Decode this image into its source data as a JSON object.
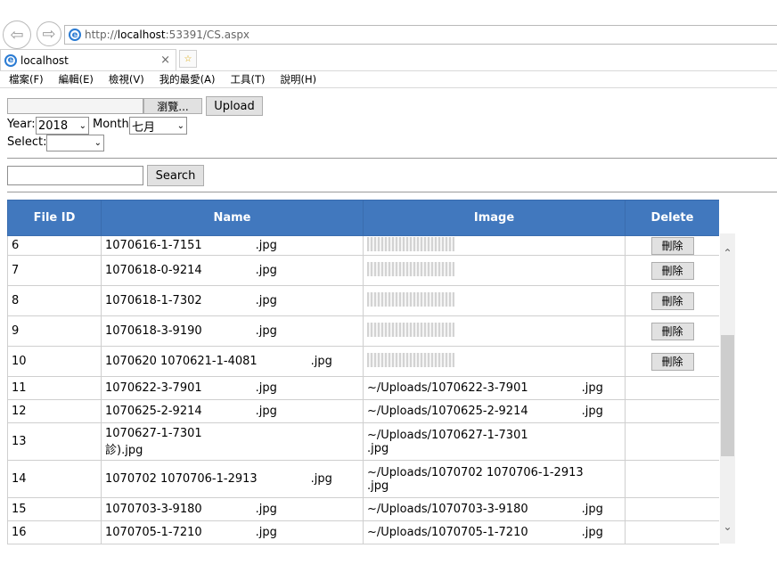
{
  "browser": {
    "url_prefix": "http://",
    "url_host": "localhost",
    "url_rest": ":53391/CS.aspx",
    "tab_title": "localhost",
    "tab_close": "×",
    "menu": [
      "檔案(F)",
      "編輯(E)",
      "檢視(V)",
      "我的最愛(A)",
      "工具(T)",
      "說明(H)"
    ]
  },
  "form": {
    "browse_label": "瀏覽...",
    "upload_label": "Upload",
    "year_label": "Year:",
    "year_value": "2018",
    "month_label": "Month:",
    "month_value": "七月",
    "select_label": "Select:",
    "select_value": "",
    "search_value": "",
    "search_label": "Search"
  },
  "grid": {
    "headers": [
      "File ID",
      "Name",
      "Image",
      "Delete"
    ],
    "delete_label": "刪除",
    "rows": [
      {
        "id": "6",
        "name": "1070616-1-7151",
        "ext": ".jpg",
        "image": "",
        "has_thumb": true,
        "has_delete": true
      },
      {
        "id": "7",
        "name": "1070618-0-9214",
        "ext": ".jpg",
        "image": "",
        "has_thumb": true,
        "has_delete": true
      },
      {
        "id": "8",
        "name": "1070618-1-7302",
        "ext": ".jpg",
        "image": "",
        "has_thumb": true,
        "has_delete": true
      },
      {
        "id": "9",
        "name": "1070618-3-9190",
        "ext": ".jpg",
        "image": "",
        "has_thumb": true,
        "has_delete": true
      },
      {
        "id": "10",
        "name": "1070620 1070621-1-4081",
        "ext": ".jpg",
        "image": "",
        "has_thumb": true,
        "has_delete": true
      },
      {
        "id": "11",
        "name": "1070622-3-7901",
        "ext": ".jpg",
        "image": "~/Uploads/1070622-3-7901",
        "image_ext": ".jpg",
        "has_thumb": false,
        "has_delete": false
      },
      {
        "id": "12",
        "name": "1070625-2-9214",
        "ext": ".jpg",
        "image": "~/Uploads/1070625-2-9214",
        "image_ext": ".jpg",
        "has_thumb": false,
        "has_delete": false
      },
      {
        "id": "13",
        "name": "1070627-1-7301",
        "ext": "診).jpg",
        "image": "~/Uploads/1070627-1-7301",
        "image_ext": ".jpg",
        "has_thumb": false,
        "has_delete": false
      },
      {
        "id": "14",
        "name": "1070702 1070706-1-2913",
        "ext": ".jpg",
        "image": "~/Uploads/1070702 1070706-1-2913",
        "image_ext": ".jpg",
        "has_thumb": false,
        "has_delete": false
      },
      {
        "id": "15",
        "name": "1070703-3-9180",
        "ext": ".jpg",
        "image": "~/Uploads/1070703-3-9180",
        "image_ext": ".jpg",
        "has_thumb": false,
        "has_delete": false
      },
      {
        "id": "16",
        "name": "1070705-1-7210",
        "ext": ".jpg",
        "image": "~/Uploads/1070705-1-7210",
        "image_ext": ".jpg",
        "has_thumb": false,
        "has_delete": false
      }
    ]
  },
  "colors": {
    "header_bg": "#4178be",
    "header_text": "#ffffff"
  }
}
